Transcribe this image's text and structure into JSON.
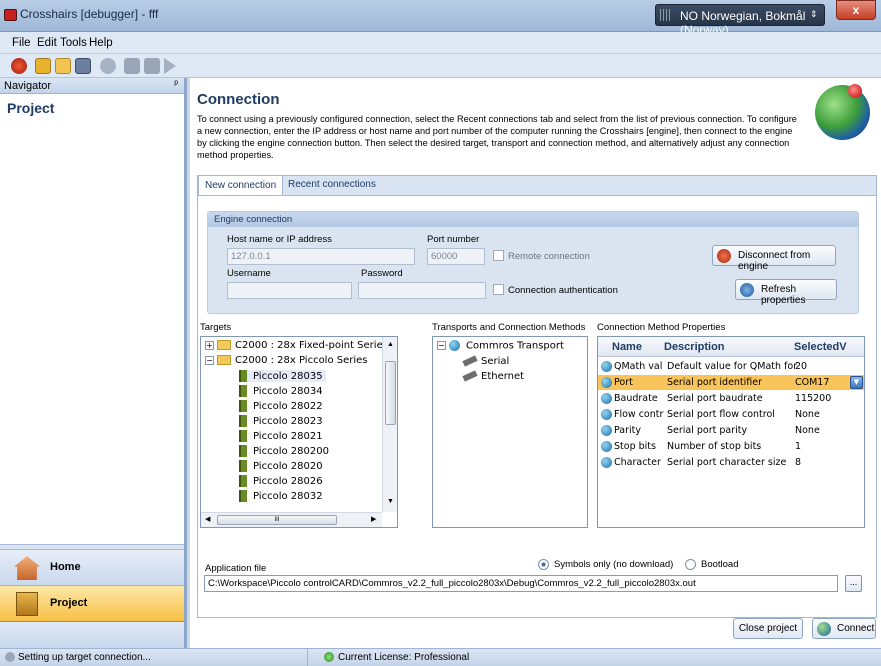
{
  "window": {
    "title": "Crosshairs [debugger] - fff",
    "language": "NO Norwegian, Bokmål (Norway)",
    "close_glyph": "x"
  },
  "menu": {
    "items": [
      "File",
      "Edit",
      "Tools",
      "Help"
    ]
  },
  "toolbar": {
    "icons": [
      "stop-icon",
      "new-project-icon",
      "open-folder-icon",
      "save-icon",
      "record-icon",
      "skip-back-icon",
      "stop-square-icon",
      "play-icon"
    ]
  },
  "navigator": {
    "header": "Navigator",
    "pin_glyph": "ᵖ",
    "title": "Project",
    "home_label": "Home",
    "project_label": "Project"
  },
  "connection": {
    "title": "Connection",
    "description": "To connect using a previously configured connection, select the Recent connections tab and select from the list of previous connection. To configure a new connection, enter the IP address or host name and port number of the computer running the Crosshairs [engine], then connect to the engine by clicking the engine connection button. Then select the desired target, transport and connection method, and alternatively adjust any connection method properties.",
    "tabs": [
      "New connection",
      "Recent connections"
    ],
    "engine": {
      "header": "Engine connection",
      "host_label": "Host name or IP address",
      "host_value": "127.0.0.1",
      "port_label": "Port number",
      "port_value": "60000",
      "remote_label": "Remote connection",
      "username_label": "Username",
      "password_label": "Password",
      "auth_label": "Connection authentication",
      "disconnect_label": "Disconnect from engine",
      "refresh_label": "Refresh properties"
    },
    "targets": {
      "label": "Targets",
      "items": [
        "C2000 : 28x Fixed-point Series",
        "C2000 : 28x Piccolo Series",
        "Piccolo 28035",
        "Piccolo 28034",
        "Piccolo 28022",
        "Piccolo 28023",
        "Piccolo 28021",
        "Piccolo 280200",
        "Piccolo 28020",
        "Piccolo 28026",
        "Piccolo 28032"
      ]
    },
    "transports": {
      "label": "Transports and Connection Methods",
      "items": [
        "Commros Transport",
        "Serial",
        "Ethernet"
      ]
    },
    "properties": {
      "label": "Connection Method Properties",
      "columns": [
        "Name",
        "Description",
        "SelectedV"
      ],
      "rows": [
        [
          "QMath val",
          "Default value for QMath for",
          "20"
        ],
        [
          "Port",
          "Serial port identifier",
          "COM17"
        ],
        [
          "Baudrate",
          "Serial port baudrate",
          "115200"
        ],
        [
          "Flow contr",
          "Serial port flow control",
          "None"
        ],
        [
          "Parity",
          "Serial port parity",
          "None"
        ],
        [
          "Stop bits",
          "Number of stop bits",
          "1"
        ],
        [
          "Character",
          "Serial port character size",
          "8"
        ]
      ]
    },
    "application": {
      "label": "Application file",
      "symbols_label": "Symbols only (no download)",
      "bootload_label": "Bootload",
      "path": "C:\\Workspace\\Piccolo controlCARD\\Commros_v2.2_full_piccolo2803x\\Debug\\Commros_v2.2_full_piccolo2803x.out",
      "browse_label": "..."
    },
    "close_project_label": "Close project",
    "connect_label": "Connect"
  },
  "status": {
    "message": "Setting up target connection...",
    "license": "Current License: Professional"
  },
  "scroll_glyph": "III",
  "colors": {
    "selected_row": "#f9c45a",
    "accent": "#1e3c64"
  }
}
